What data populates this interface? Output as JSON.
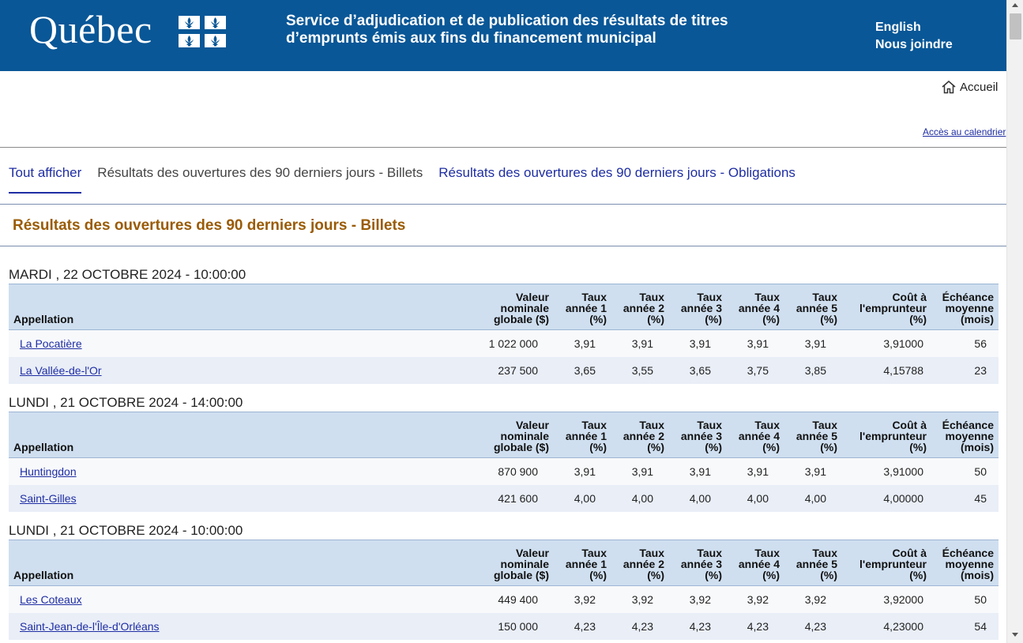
{
  "header": {
    "logo_text": "Québec",
    "service_title": "Service d’adjudication et de publication des résultats de titres d’emprunts émis aux fins du financement municipal",
    "links": [
      "English",
      "Nous joindre"
    ],
    "bg_color": "#095797"
  },
  "utility": {
    "home_label": "Accueil",
    "calendar_label": "Accès au calendrier"
  },
  "tabs": [
    {
      "label": "Tout afficher",
      "active": true
    },
    {
      "label": "Résultats des ouvertures des 90 derniers jours - Billets"
    },
    {
      "label": "Résultats des ouvertures des 90 derniers jours - Obligations"
    }
  ],
  "section_title": "Résultats des ouvertures des 90 derniers jours - Billets",
  "columns": [
    "Appellation",
    "Valeur nominale globale ($)",
    "Taux année 1 (%)",
    "Taux année 2 (%)",
    "Taux année 3 (%)",
    "Taux année 4 (%)",
    "Taux année 5 (%)",
    "Coût à l'emprunteur (%)",
    "Échéance moyenne (mois)"
  ],
  "sessions": [
    {
      "date": "MARDI , 22 OCTOBRE 2024 - 10:00:00",
      "rows": [
        [
          "La Pocatière",
          "1 022 000",
          "3,91",
          "3,91",
          "3,91",
          "3,91",
          "3,91",
          "3,91000",
          "56"
        ],
        [
          "La Vallée-de-l'Or",
          "237 500",
          "3,65",
          "3,55",
          "3,65",
          "3,75",
          "3,85",
          "4,15788",
          "23"
        ]
      ]
    },
    {
      "date": "LUNDI , 21 OCTOBRE 2024 - 14:00:00",
      "rows": [
        [
          "Huntingdon",
          "870 900",
          "3,91",
          "3,91",
          "3,91",
          "3,91",
          "3,91",
          "3,91000",
          "50"
        ],
        [
          "Saint-Gilles",
          "421 600",
          "4,00",
          "4,00",
          "4,00",
          "4,00",
          "4,00",
          "4,00000",
          "45"
        ]
      ]
    },
    {
      "date": "LUNDI , 21 OCTOBRE 2024 - 10:00:00",
      "rows": [
        [
          "Les Coteaux",
          "449 400",
          "3,92",
          "3,92",
          "3,92",
          "3,92",
          "3,92",
          "3,92000",
          "50"
        ],
        [
          "Saint-Jean-de-l'Île-d'Orléans",
          "150 000",
          "4,23",
          "4,23",
          "4,23",
          "4,23",
          "4,23",
          "4,23000",
          "54"
        ]
      ]
    }
  ]
}
